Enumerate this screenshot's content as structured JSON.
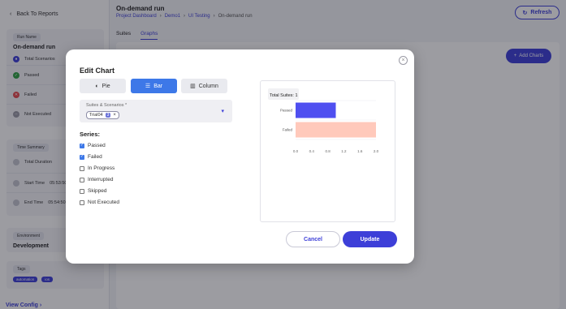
{
  "sidebar": {
    "back_label": "Back To Reports",
    "run_name_chip": "Run Name",
    "run_name": "On-demand run",
    "stats": [
      {
        "label": "Total Scenarios",
        "color": "#3d3fd8"
      },
      {
        "label": "Passed",
        "color": "#2ea043"
      },
      {
        "label": "Failed",
        "color": "#e5484d"
      },
      {
        "label": "Not Executed",
        "color": "#9a9aa5"
      }
    ],
    "time_summary_chip": "Time Summary",
    "time_rows": [
      {
        "label": "Total Duration",
        "value": ""
      },
      {
        "label": "Start Time",
        "value": "05:53:50"
      },
      {
        "label": "End Time",
        "value": "05:54:50"
      }
    ],
    "environment_chip": "Environment",
    "environment": "Development",
    "tags_chip": "Tags",
    "tags": [
      "automation",
      "ios"
    ],
    "view_config": "View Config"
  },
  "header": {
    "title": "On-demand run",
    "breadcrumb": [
      "Project Dashboard",
      "Demo1",
      "UI Testing",
      "On-demand run"
    ],
    "refresh_label": "Refresh"
  },
  "tabs": [
    "Suites",
    "Graphs"
  ],
  "add_charts_label": "Add Charts",
  "modal": {
    "title": "Edit Chart",
    "close_icon": "close-icon",
    "chart_types": [
      {
        "label": "Pie",
        "icon": "pie-icon",
        "active": false
      },
      {
        "label": "Bar",
        "icon": "bar-icon",
        "active": true
      },
      {
        "label": "Column",
        "icon": "column-icon",
        "active": false
      }
    ],
    "select": {
      "label": "Suites & Scenarios *",
      "chip_text": "Trial04",
      "chip_count": "3"
    },
    "series_title": "Series:",
    "series": [
      {
        "label": "Passed",
        "checked": true
      },
      {
        "label": "Failed",
        "checked": true
      },
      {
        "label": "In Progress",
        "checked": false
      },
      {
        "label": "Interrupted",
        "checked": false
      },
      {
        "label": "Skipped",
        "checked": false
      },
      {
        "label": "Not Executed",
        "checked": false
      }
    ],
    "cancel_label": "Cancel",
    "update_label": "Update"
  },
  "chart_data": {
    "type": "bar",
    "orientation": "horizontal",
    "title": "Total Suites: 1",
    "categories": [
      "Passed",
      "Failed"
    ],
    "values": [
      1.0,
      2.0
    ],
    "colors": [
      "#4f4ff0",
      "#ffc9bb"
    ],
    "xlim": [
      0,
      2
    ],
    "ticks": [
      "0.0",
      "0.4",
      "0.8",
      "1.2",
      "1.6",
      "2.0"
    ],
    "grid": true
  }
}
